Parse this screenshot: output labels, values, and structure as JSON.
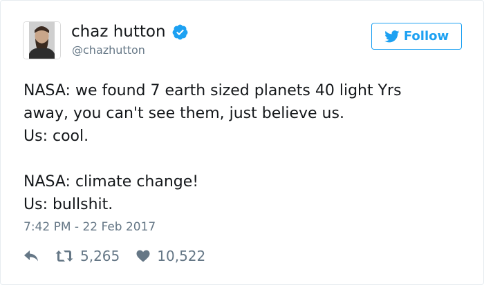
{
  "tweet": {
    "display_name": "chaz hutton",
    "screen_name": "@chazhutton",
    "follow_label": "Follow",
    "text_lines": [
      "NASA: we found 7 earth sized planets 40 light Yrs",
      "away, you can't see them, just believe us.",
      "Us: cool.",
      "",
      "NASA: climate change!",
      "Us: bullshit."
    ],
    "timestamp": "7:42 PM - 22 Feb 2017",
    "retweet_count": "5,265",
    "like_count": "10,522"
  },
  "icons": {
    "verified": "verified-badge-icon",
    "bird": "twitter-bird-icon",
    "reply": "reply-icon",
    "retweet": "retweet-icon",
    "like": "heart-icon"
  },
  "colors": {
    "accent": "#1da1f2",
    "text": "#14171a",
    "muted": "#657786",
    "border": "#e6ecf0"
  }
}
